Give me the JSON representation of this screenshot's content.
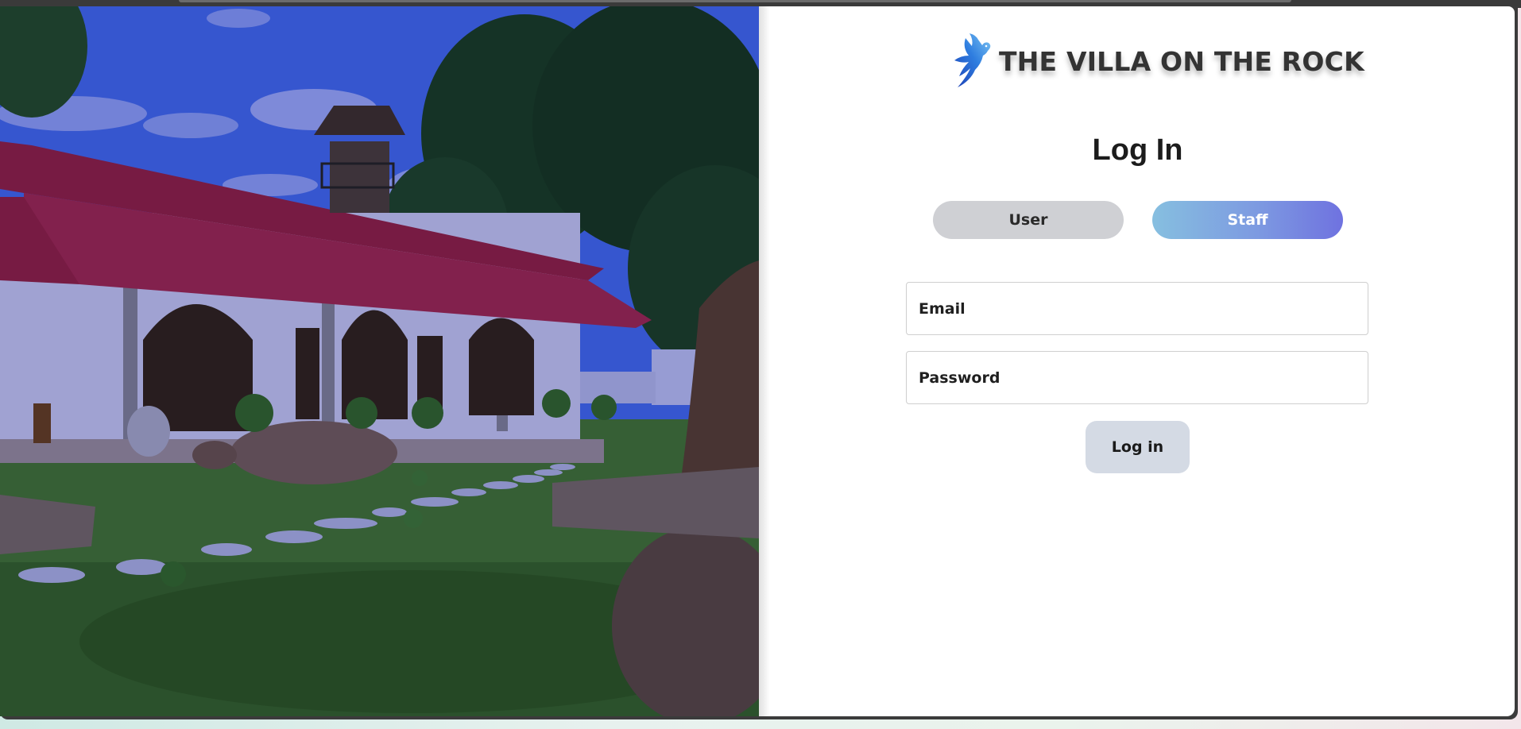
{
  "brand": {
    "name": "THE VILLA ON THE ROCK",
    "logo_icon": "bird-icon",
    "logo_colors": [
      "#1b3fb5",
      "#2f7ee0",
      "#7cc4f2"
    ]
  },
  "login": {
    "heading": "Log In",
    "tabs": {
      "user_label": "User",
      "staff_label": "Staff",
      "selected": "Staff"
    },
    "email": {
      "placeholder": "Email",
      "value": ""
    },
    "password": {
      "placeholder": "Password",
      "value": ""
    },
    "submit_label": "Log in"
  },
  "colors": {
    "staff_gradient_start": "#86bfe0",
    "staff_gradient_end": "#6f72e0",
    "user_tab_bg": "#cfd0d4",
    "submit_bg": "#d4dae4",
    "photo_tint": "#2a2dbe"
  },
  "photo": {
    "subject": "villa-exterior-photo"
  }
}
